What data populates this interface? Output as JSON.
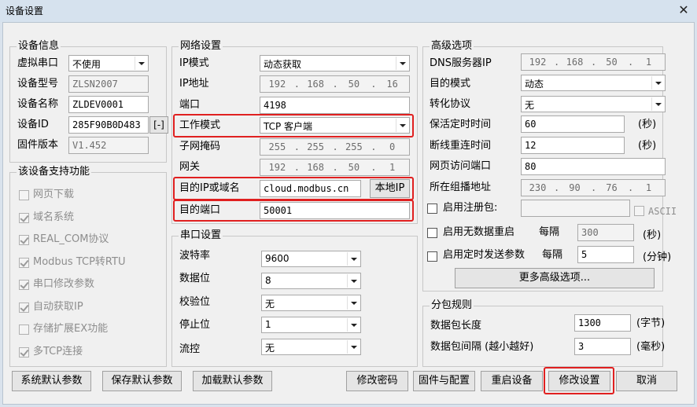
{
  "window": {
    "title": "设备设置",
    "close_glyph": "✕"
  },
  "device_info": {
    "legend": "设备信息",
    "virtual_port_label": "虚拟串口",
    "virtual_port_value": "不使用",
    "model_label": "设备型号",
    "model_value": "ZLSN2007",
    "name_label": "设备名称",
    "name_value": "ZLDEV0001",
    "id_label": "设备ID",
    "id_value": "285F90B0D483",
    "id_toggle": "[-]",
    "firmware_label": "固件版本",
    "firmware_value": "V1.452"
  },
  "features": {
    "legend": "该设备支持功能",
    "items": [
      {
        "label": "网页下载",
        "checked": false
      },
      {
        "label": "域名系统",
        "checked": true
      },
      {
        "label": "REAL_COM协议",
        "checked": true
      },
      {
        "label": "Modbus TCP转RTU",
        "checked": true
      },
      {
        "label": "串口修改参数",
        "checked": true
      },
      {
        "label": "自动获取IP",
        "checked": true
      },
      {
        "label": "存储扩展EX功能",
        "checked": false
      },
      {
        "label": "多TCP连接",
        "checked": true
      }
    ]
  },
  "network": {
    "legend": "网络设置",
    "ip_mode_label": "IP模式",
    "ip_mode_value": "动态获取",
    "ip_label": "IP地址",
    "ip_octets": [
      "192",
      "168",
      "50",
      "16"
    ],
    "port_label": "端口",
    "port_value": "4198",
    "work_mode_label": "工作模式",
    "work_mode_value": "TCP 客户端",
    "mask_label": "子网掩码",
    "mask_octets": [
      "255",
      "255",
      "255",
      "0"
    ],
    "gateway_label": "网关",
    "gateway_octets": [
      "192",
      "168",
      "50",
      "1"
    ],
    "dest_ip_label": "目的IP或域名",
    "dest_ip_value": "cloud.modbus.cn",
    "local_ip_button": "本地IP",
    "dest_port_label": "目的端口",
    "dest_port_value": "50001"
  },
  "serial": {
    "legend": "串口设置",
    "baud_label": "波特率",
    "baud_value": "9600",
    "data_bits_label": "数据位",
    "data_bits_value": "8",
    "parity_label": "校验位",
    "parity_value": "无",
    "stop_bits_label": "停止位",
    "stop_bits_value": "1",
    "flow_label": "流控",
    "flow_value": "无"
  },
  "advanced": {
    "legend": "高级选项",
    "dns_label": "DNS服务器IP",
    "dns_octets": [
      "192",
      "168",
      "50",
      "1"
    ],
    "dest_mode_label": "目的模式",
    "dest_mode_value": "动态",
    "protocol_label": "转化协议",
    "protocol_value": "无",
    "keepalive_label": "保活定时时间",
    "keepalive_value": "60",
    "keepalive_unit": "(秒)",
    "reconnect_label": "断线重连时间",
    "reconnect_value": "12",
    "reconnect_unit": "(秒)",
    "web_port_label": "网页访问端口",
    "web_port_value": "80",
    "multicast_label": "所在组播地址",
    "multicast_octets": [
      "230",
      "90",
      "76",
      "1"
    ],
    "register_label": "启用注册包:",
    "register_value": "",
    "ascii_label": "ASCII",
    "nodata_label": "启用无数据重启",
    "nodata_every": "每隔",
    "nodata_value": "300",
    "nodata_unit": "(秒)",
    "timed_label": "启用定时发送参数",
    "timed_every": "每隔",
    "timed_value": "5",
    "timed_unit": "(分钟)",
    "more_button": "更多高级选项..."
  },
  "packet": {
    "legend": "分包规则",
    "length_label": "数据包长度",
    "length_value": "1300",
    "length_unit": "(字节)",
    "interval_label": "数据包间隔 (越小越好)",
    "interval_value": "3",
    "interval_unit": "(毫秒)"
  },
  "buttons": {
    "sys_default": "系统默认参数",
    "save_default": "保存默认参数",
    "load_default": "加载默认参数",
    "change_password": "修改密码",
    "firmware_config": "固件与配置",
    "restart": "重启设备",
    "apply": "修改设置",
    "cancel": "取消"
  },
  "colors": {
    "highlight": "#e02020",
    "window_bg": "#f0f0f0",
    "titlebar": "#d6e2ee"
  }
}
